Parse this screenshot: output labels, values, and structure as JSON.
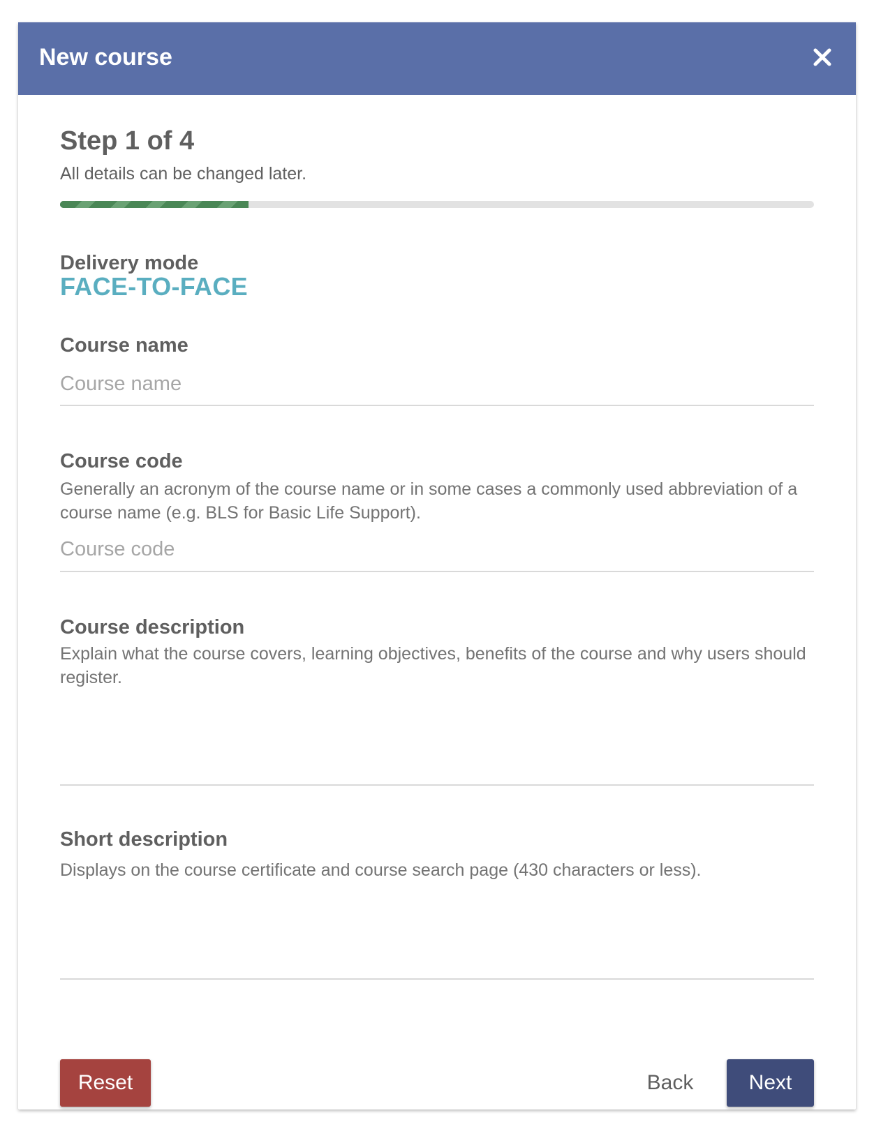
{
  "dialog": {
    "title": "New course",
    "close_icon": "close-icon",
    "header_color": "#5a6fa8"
  },
  "step": {
    "title": "Step 1 of 4",
    "subtitle": "All details can be changed later.",
    "progress": 0.25
  },
  "delivery_mode": {
    "label": "Delivery mode",
    "value": "FACE-TO-FACE",
    "value_color": "#5aaec0"
  },
  "course_name": {
    "label": "Course name",
    "value": "",
    "placeholder": "Course name"
  },
  "course_code": {
    "label": "Course code",
    "help": "Generally an acronym of the course name or in some cases a commonly used abbreviation of a course name (e.g. BLS for Basic Life Support).",
    "value": "",
    "placeholder": "Course code"
  },
  "course_description": {
    "label": "Course description",
    "help": "Explain what the course covers, learning objectives, benefits of the course and why users should register.",
    "value": ""
  },
  "short_description": {
    "label": "Short description",
    "help": "Displays on the course certificate and course search page (430 characters or less).",
    "value": ""
  },
  "actions": {
    "reset_label": "Reset",
    "back_label": "Back",
    "next_label": "Next",
    "reset_color": "#a5433f",
    "next_color": "#3f4c7a"
  }
}
